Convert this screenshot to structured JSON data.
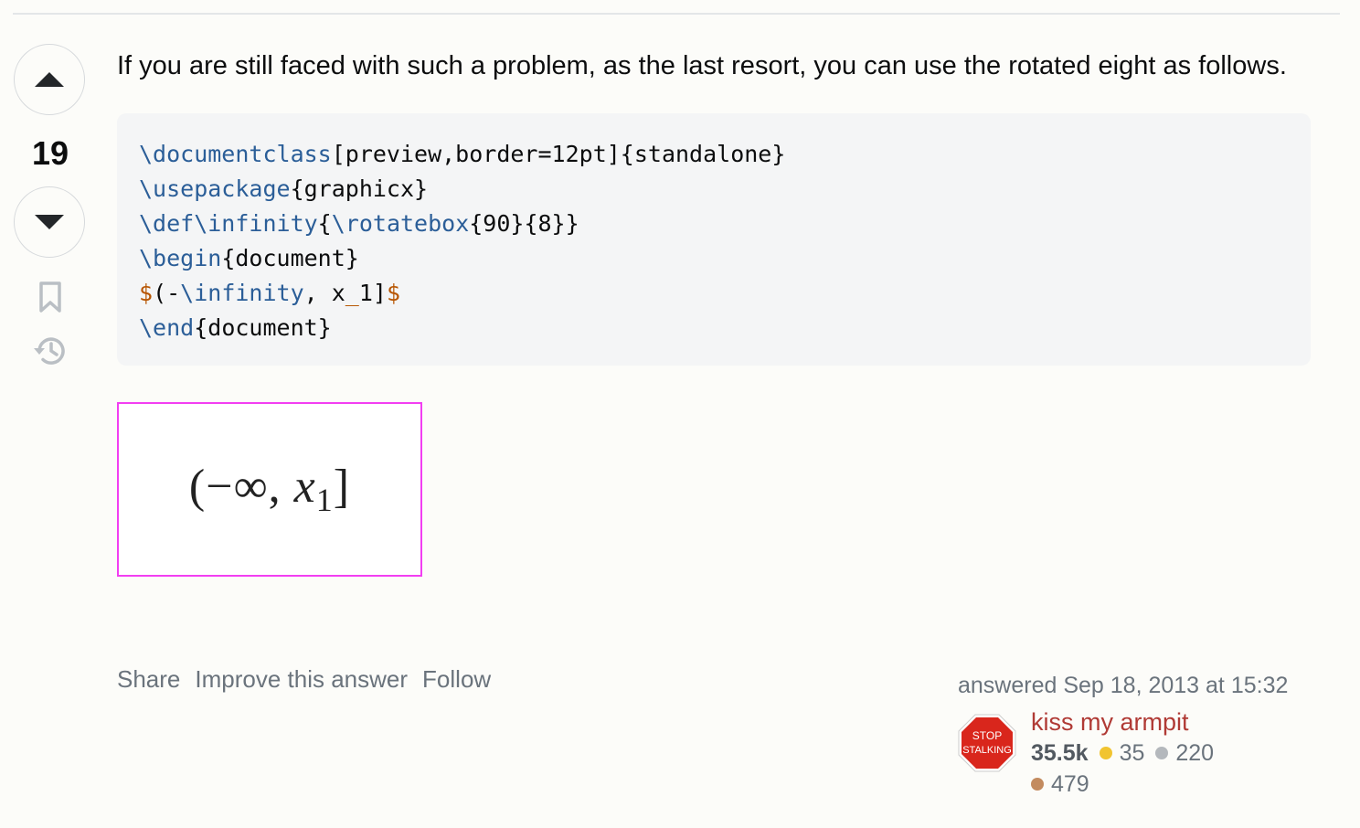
{
  "post": {
    "score": "19",
    "text": "If you are still faced with such a problem, as the last resort, you can use the rotated eight as follows.",
    "rendered_output": {
      "open": "(−",
      "infinity": "∞",
      "comma": ", ",
      "var": "x",
      "sub": "1",
      "close": "]"
    }
  },
  "code": {
    "lines": [
      [
        {
          "t": "\\documentclass",
          "c": "kw"
        },
        {
          "t": "[preview,border=12pt]{standalone}",
          "c": ""
        }
      ],
      [
        {
          "t": "\\usepackage",
          "c": "kw"
        },
        {
          "t": "{graphicx}",
          "c": ""
        }
      ],
      [
        {
          "t": "\\def\\infinity",
          "c": "kw"
        },
        {
          "t": "{",
          "c": ""
        },
        {
          "t": "\\rotatebox",
          "c": "kw"
        },
        {
          "t": "{90}{8}}",
          "c": ""
        }
      ],
      [
        {
          "t": "\\begin",
          "c": "kw"
        },
        {
          "t": "{document}",
          "c": ""
        }
      ],
      [
        {
          "t": "$",
          "c": "dl"
        },
        {
          "t": "(-",
          "c": ""
        },
        {
          "t": "\\infinity",
          "c": "kw"
        },
        {
          "t": ", x",
          "c": ""
        },
        {
          "t": "_",
          "c": "dl"
        },
        {
          "t": "1]",
          "c": ""
        },
        {
          "t": "$",
          "c": "dl"
        }
      ],
      [
        {
          "t": "\\end",
          "c": "kw"
        },
        {
          "t": "{document}",
          "c": ""
        }
      ]
    ]
  },
  "menu": {
    "share": "Share",
    "improve": "Improve this answer",
    "follow": "Follow"
  },
  "user": {
    "answered": "answered Sep 18, 2013 at 15:32",
    "avatar_line1": "STOP",
    "avatar_line2": "STALKING",
    "name": "kiss my armpit",
    "reputation": "35.5k",
    "gold": "35",
    "silver": "220",
    "bronze": "479"
  },
  "colors": {
    "keyword": "#2b5e98",
    "delimiter": "#b75501",
    "user_link": "#b03a35",
    "image_border": "#f23ef2"
  }
}
